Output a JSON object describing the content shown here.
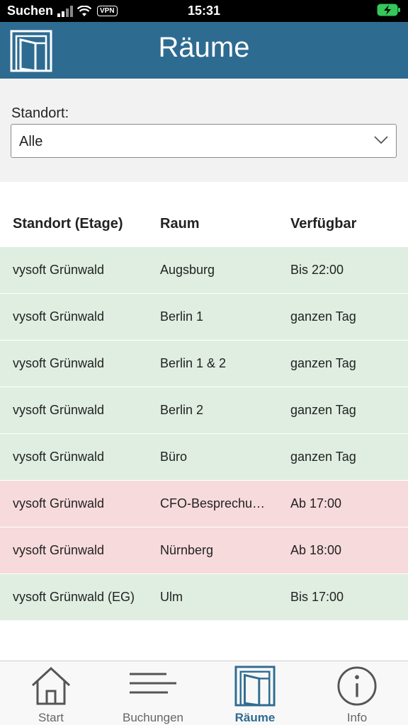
{
  "status_bar": {
    "carrier": "Suchen",
    "vpn": "VPN",
    "time": "15:31"
  },
  "header": {
    "title": "Räume",
    "background": "#2e6b91"
  },
  "filter": {
    "label": "Standort:",
    "selected": "Alle"
  },
  "table": {
    "columns": [
      "Standort (Etage)",
      "Raum",
      "Verfügbar"
    ],
    "rows": [
      {
        "standort": "vysoft Grünwald",
        "raum": "Augsburg",
        "verfuegbar": "Bis 22:00",
        "status": "available"
      },
      {
        "standort": "vysoft Grünwald",
        "raum": "Berlin 1",
        "verfuegbar": "ganzen Tag",
        "status": "available"
      },
      {
        "standort": "vysoft Grünwald",
        "raum": "Berlin 1 & 2",
        "verfuegbar": "ganzen Tag",
        "status": "available"
      },
      {
        "standort": "vysoft Grünwald",
        "raum": "Berlin 2",
        "verfuegbar": "ganzen Tag",
        "status": "available"
      },
      {
        "standort": "vysoft Grünwald",
        "raum": "Büro",
        "verfuegbar": "ganzen Tag",
        "status": "available"
      },
      {
        "standort": "vysoft Grünwald",
        "raum": "CFO-Besprechun...",
        "verfuegbar": "Ab 17:00",
        "status": "busy"
      },
      {
        "standort": "vysoft Grünwald",
        "raum": "Nürnberg",
        "verfuegbar": "Ab 18:00",
        "status": "busy"
      },
      {
        "standort": "vysoft Grünwald (EG)",
        "raum": "Ulm",
        "verfuegbar": "Bis 17:00",
        "status": "available"
      }
    ],
    "colors": {
      "available": "#dfeee1",
      "busy": "#f7dadc"
    }
  },
  "tabs": [
    {
      "label": "Start",
      "icon": "home-icon",
      "active": false
    },
    {
      "label": "Buchungen",
      "icon": "list-icon",
      "active": false
    },
    {
      "label": "Räume",
      "icon": "door-icon",
      "active": true
    },
    {
      "label": "Info",
      "icon": "info-icon",
      "active": false
    }
  ]
}
